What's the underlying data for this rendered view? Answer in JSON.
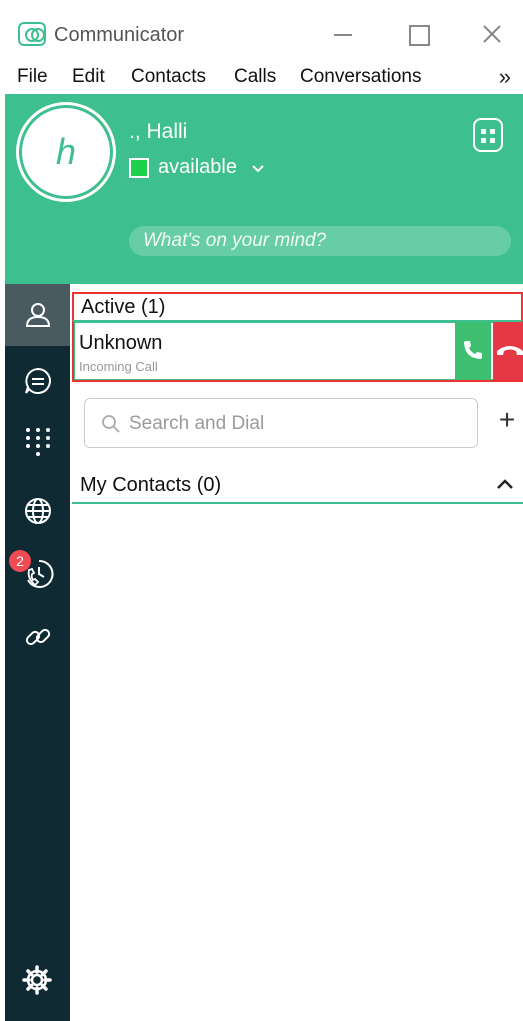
{
  "window": {
    "title": "Communicator"
  },
  "menu": {
    "items": [
      "File",
      "Edit",
      "Contacts",
      "Calls",
      "Conversations"
    ],
    "more": "»"
  },
  "profile": {
    "avatar_letter": "h",
    "name": "., Halli",
    "status": "available",
    "status_color": "#1fd04b",
    "mind_placeholder": "What's on your mind?"
  },
  "sidebar": {
    "items": [
      {
        "icon": "contacts-icon",
        "active": true
      },
      {
        "icon": "chat-icon"
      },
      {
        "icon": "dialpad-icon"
      },
      {
        "icon": "globe-icon"
      },
      {
        "icon": "call-history-icon",
        "badge": "2"
      },
      {
        "icon": "link-icon"
      }
    ],
    "settings_icon": "gear-icon"
  },
  "active_calls": {
    "header": "Active (1)",
    "calls": [
      {
        "name": "Unknown",
        "subtitle": "Incoming Call"
      }
    ]
  },
  "search": {
    "placeholder": "Search and Dial",
    "add_label": "+"
  },
  "contacts": {
    "header": "My Contacts (0)"
  },
  "colors": {
    "accent": "#3dbf8f",
    "sidebar": "#0f2a33",
    "answer": "#3dbf6f",
    "decline": "#e53845",
    "highlight": "#ee3333"
  }
}
